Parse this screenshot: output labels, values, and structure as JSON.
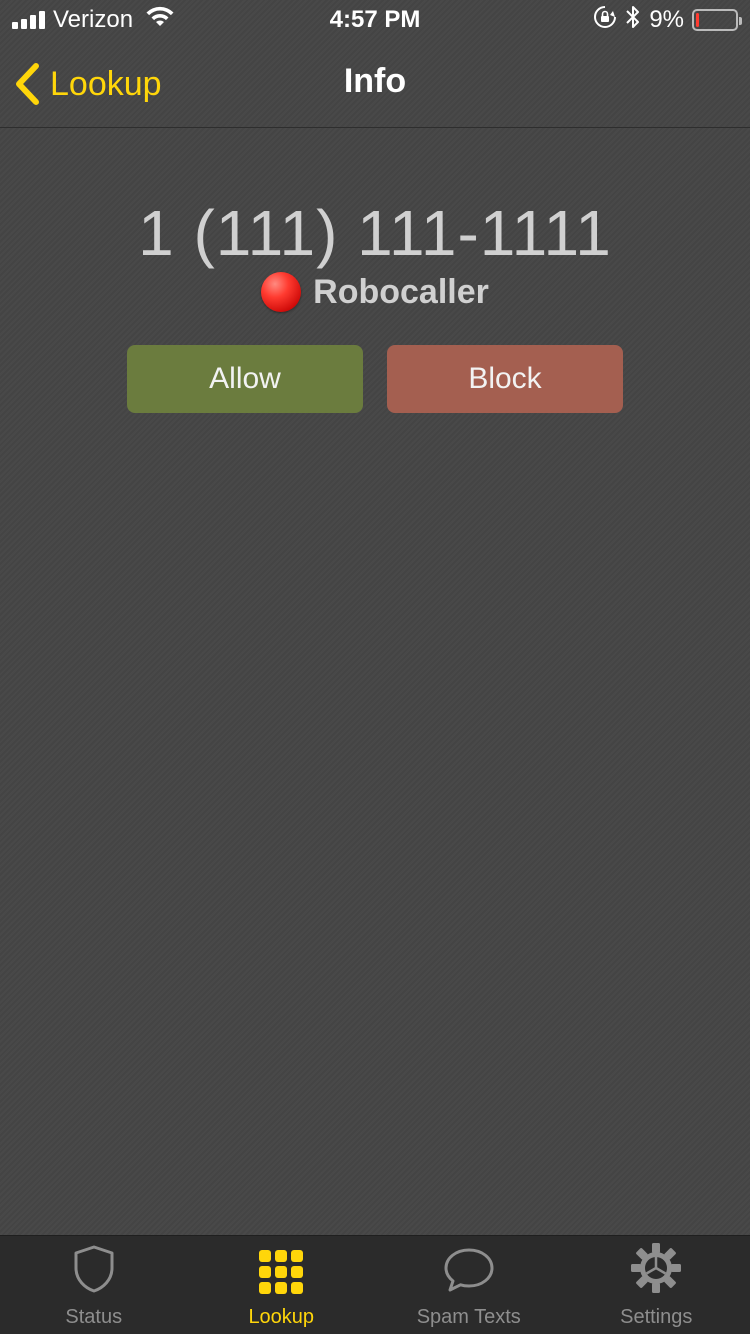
{
  "status_bar": {
    "carrier": "Verizon",
    "time": "4:57 PM",
    "battery": "9%",
    "battery_level": 0.09,
    "battery_color": "#ff3b30"
  },
  "nav": {
    "back_label": "Lookup",
    "title": "Info",
    "accent_color": "#ffd60a"
  },
  "caller": {
    "number": "1 (111) 111-1111",
    "classification": "Robocaller",
    "indicator_icon": "red-circle-icon"
  },
  "actions": {
    "allow_label": "Allow",
    "block_label": "Block",
    "allow_color": "#6b7c3e",
    "block_color": "#a45f50"
  },
  "tabs": [
    {
      "label": "Status",
      "icon": "shield-icon",
      "active": false
    },
    {
      "label": "Lookup",
      "icon": "grid-icon",
      "active": true
    },
    {
      "label": "Spam Texts",
      "icon": "chat-bubble-icon",
      "active": false
    },
    {
      "label": "Settings",
      "icon": "gear-icon",
      "active": false
    }
  ]
}
